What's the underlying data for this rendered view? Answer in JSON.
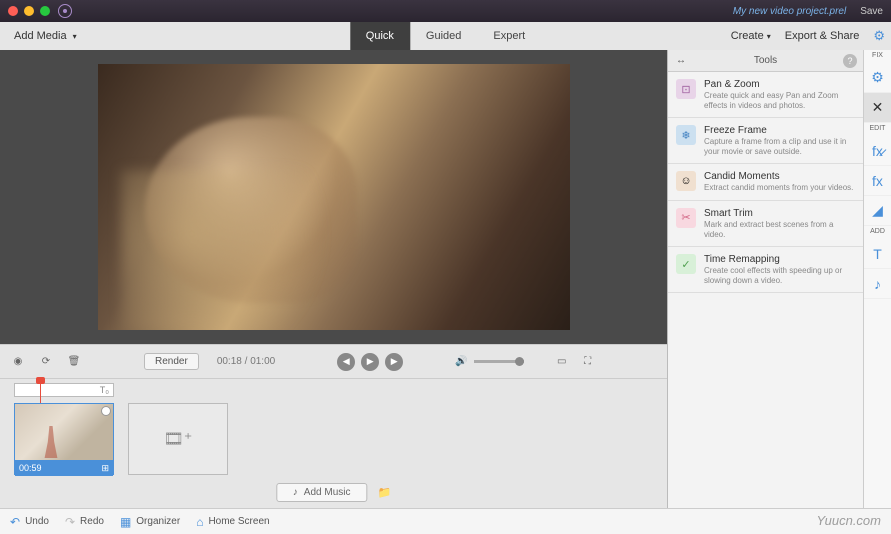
{
  "titlebar": {
    "project_name": "My new video project.prel",
    "save": "Save"
  },
  "topbar": {
    "add_media": "Add Media",
    "modes": {
      "quick": "Quick",
      "guided": "Guided",
      "expert": "Expert"
    },
    "create": "Create",
    "export": "Export & Share"
  },
  "playback": {
    "render": "Render",
    "current_time": "00:18",
    "total_time": "01:00"
  },
  "timeline": {
    "clip1_duration": "00:59",
    "add_music": "Add Music"
  },
  "panel": {
    "title": "Tools",
    "tools": [
      {
        "name": "Pan & Zoom",
        "desc": "Create quick and easy Pan and Zoom effects in videos and photos."
      },
      {
        "name": "Freeze Frame",
        "desc": "Capture a frame from a clip and use it in your movie or save outside."
      },
      {
        "name": "Candid Moments",
        "desc": "Extract candid moments from your videos."
      },
      {
        "name": "Smart Trim",
        "desc": "Mark and extract best scenes from a video."
      },
      {
        "name": "Time Remapping",
        "desc": "Create cool effects with speeding up or slowing down a video."
      }
    ]
  },
  "right_tabs": {
    "fix": "FIX",
    "edit": "EDIT",
    "add": "ADD"
  },
  "bottombar": {
    "undo": "Undo",
    "redo": "Redo",
    "organizer": "Organizer",
    "home": "Home Screen"
  },
  "watermark": "Yuucn.com"
}
